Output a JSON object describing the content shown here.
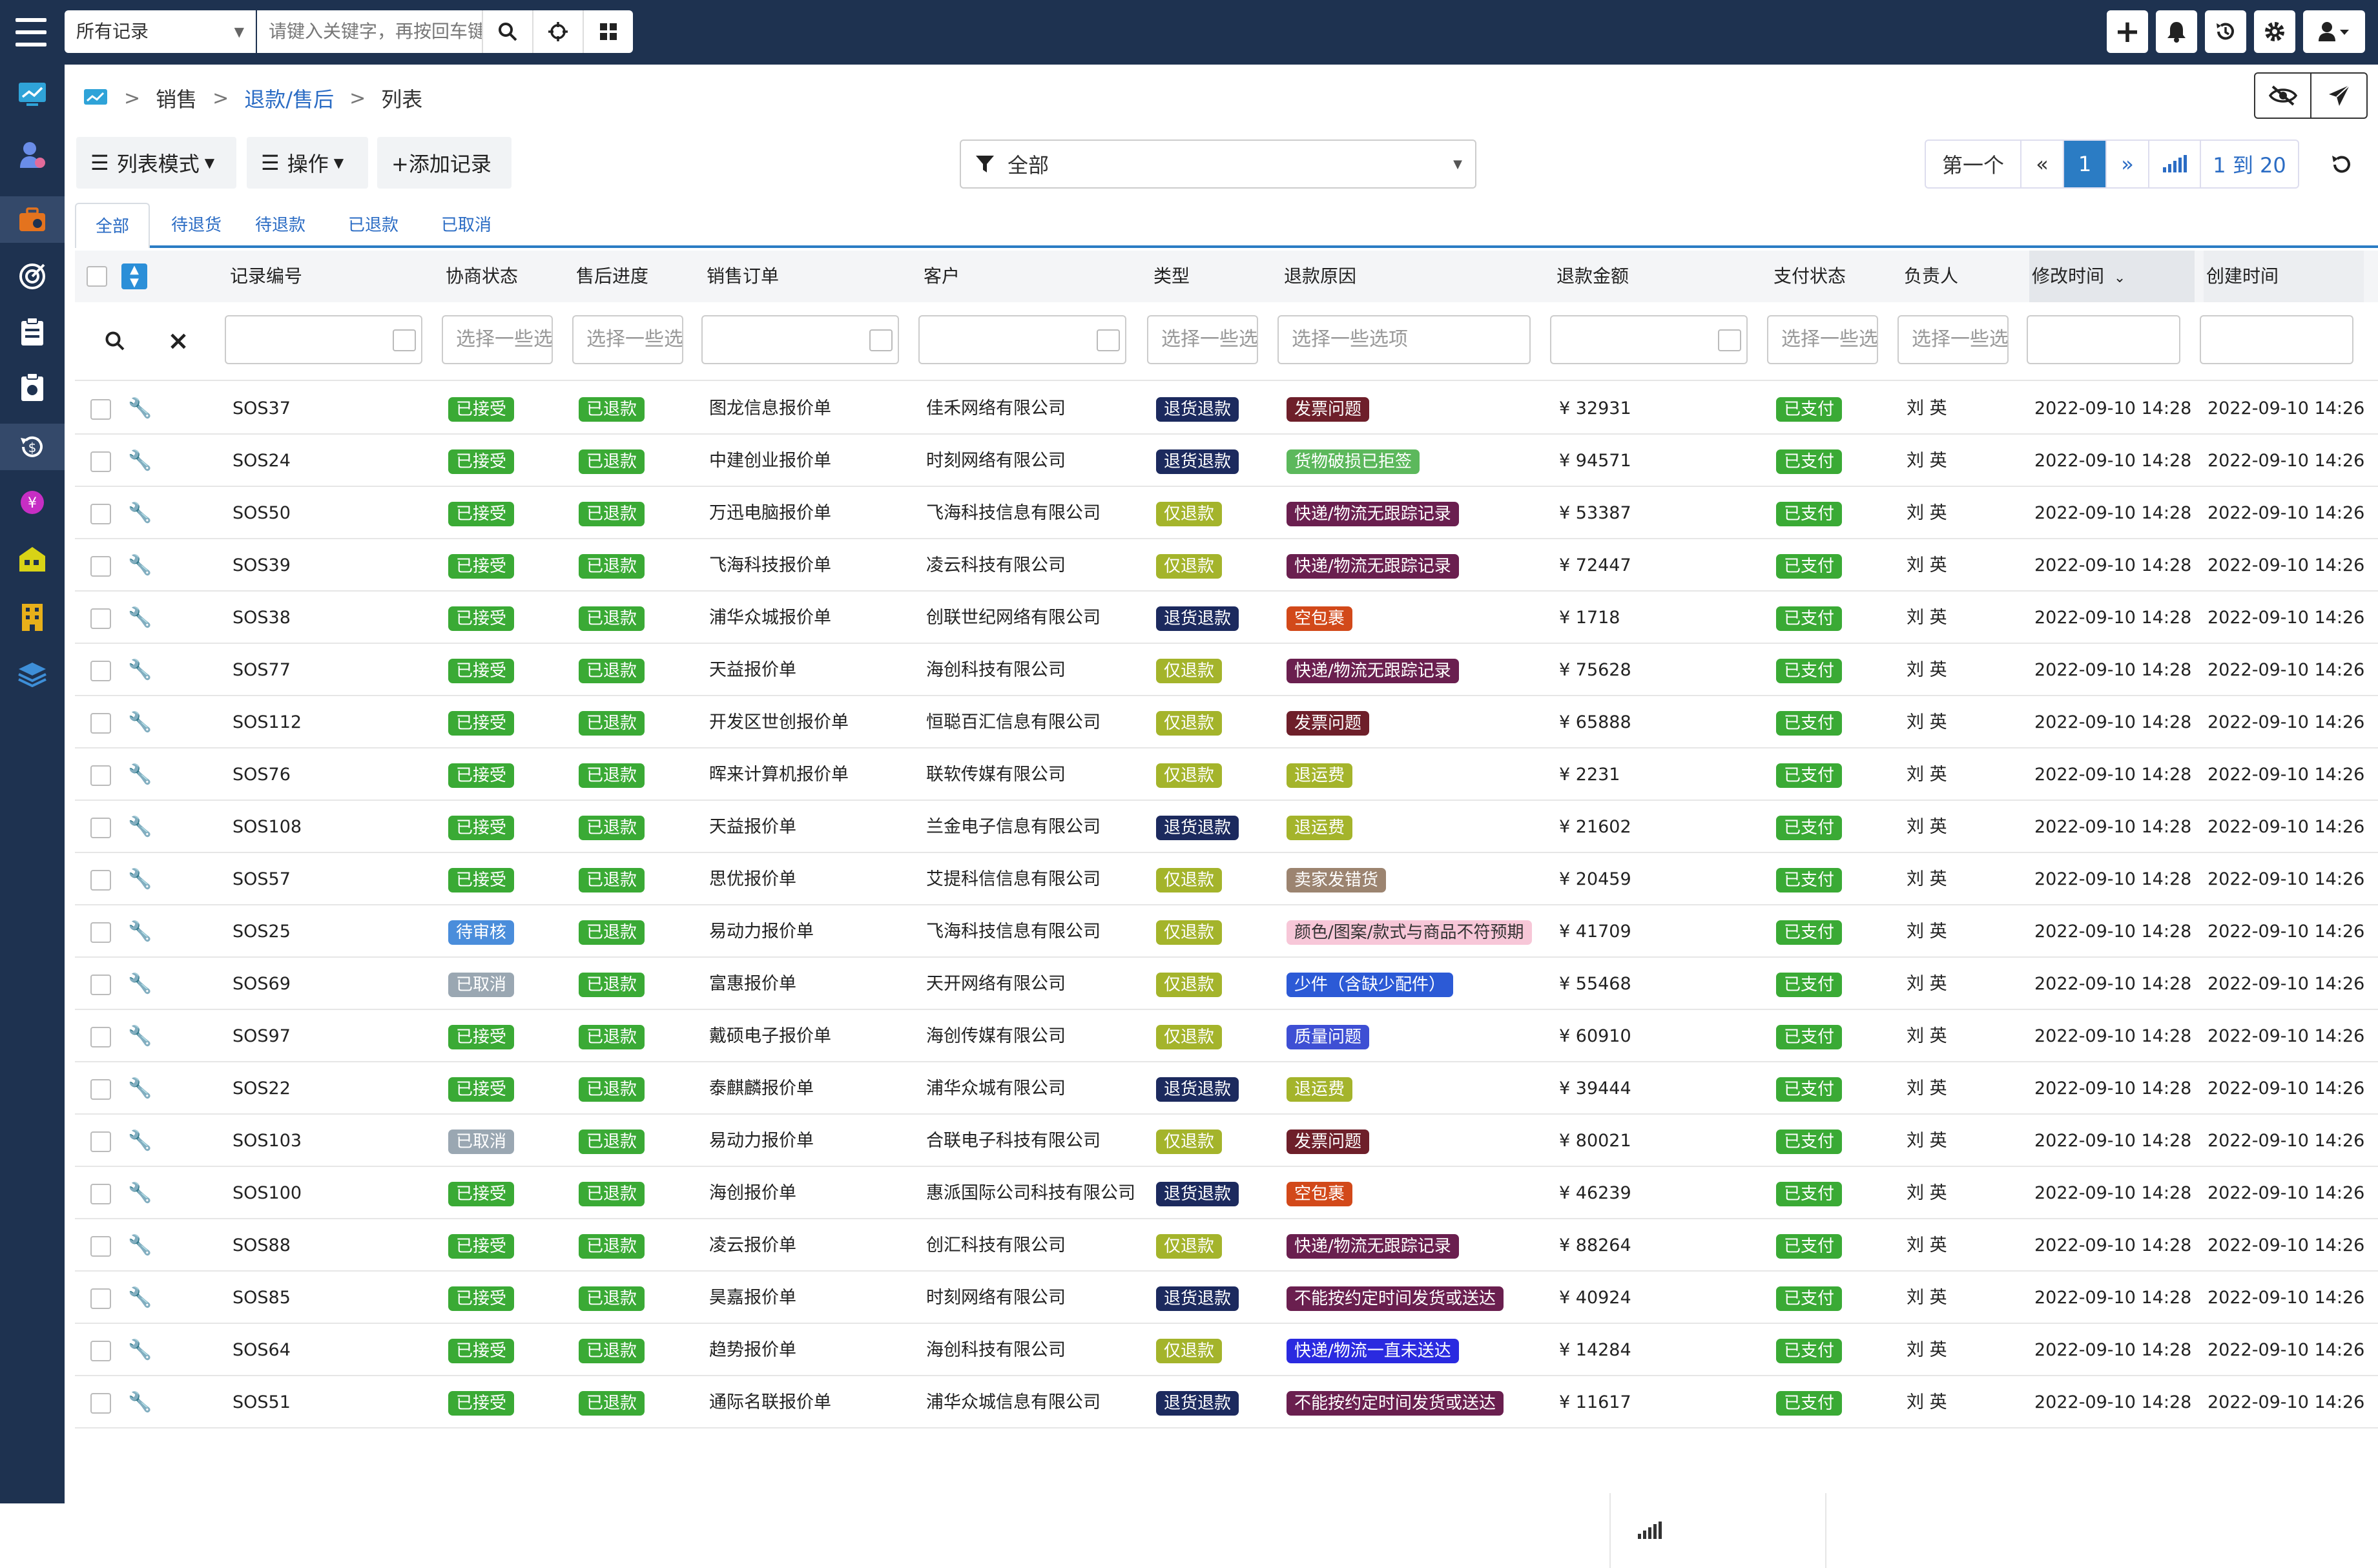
{
  "topbar": {
    "record_scope": "所有记录",
    "search_placeholder": "请键入关键字，再按回车键"
  },
  "breadcrumb": {
    "level1": "销售",
    "level2": "退款/售后",
    "level3": "列表"
  },
  "toolbar": {
    "view_mode": "列表模式",
    "operations": "操作",
    "add_record": "+添加记录",
    "filter_value": "全部"
  },
  "pager": {
    "first": "第一个",
    "prev": "«",
    "current": "1",
    "next": "»",
    "range": "1 到 20"
  },
  "tabs": [
    "全部",
    "待退货",
    "待退款",
    "已退款",
    "已取消"
  ],
  "columns": {
    "record_no": "记录编号",
    "negotiation": "协商状态",
    "progress": "售后进度",
    "sales_order": "销售订单",
    "customer": "客户",
    "type": "类型",
    "reason": "退款原因",
    "amount": "退款金额",
    "pay_status": "支付状态",
    "owner": "负责人",
    "modified": "修改时间",
    "created": "创建时间"
  },
  "filters": {
    "negotiation": "选择一些选项",
    "progress": "选择一些选项",
    "type": "选择一些选项",
    "reason": "选择一些选项",
    "pay_status": "选择一些选项",
    "owner": "选择一些选项"
  },
  "colors": {
    "green": "#3aaa35",
    "navy": "#1c2a5e",
    "olive": "#a4b42b",
    "maroon": "#6e1f2a",
    "red": "#a82c2c",
    "orange": "#d2491a",
    "purple": "#6a1f4f",
    "lightgreen": "#5cb85c",
    "brown": "#9c8470",
    "pink": "#f7c7d8",
    "blue": "#2c5ad6",
    "gray": "#9aa7b2",
    "sky": "#4a8ddb",
    "royal": "#2a2ae0",
    "indigo": "#3e4fd4"
  },
  "rows": [
    {
      "no": "SOS37",
      "neg": "已接受",
      "negc": "green",
      "prog": "已退款",
      "order": "图龙信息报价单",
      "cust": "佳禾网络有限公司",
      "type": "退货退款",
      "typec": "navy",
      "reason": "发票问题",
      "reasonc": "maroon",
      "amount": "¥ 32931",
      "pay": "已支付",
      "owner": "刘 英",
      "mod": "2022-09-10 14:28",
      "cre": "2022-09-10 14:26"
    },
    {
      "no": "SOS24",
      "neg": "已接受",
      "negc": "green",
      "prog": "已退款",
      "order": "中建创业报价单",
      "cust": "时刻网络有限公司",
      "type": "退货退款",
      "typec": "navy",
      "reason": "货物破损已拒签",
      "reasonc": "lightgreen",
      "amount": "¥ 94571",
      "pay": "已支付",
      "owner": "刘 英",
      "mod": "2022-09-10 14:28",
      "cre": "2022-09-10 14:26"
    },
    {
      "no": "SOS50",
      "neg": "已接受",
      "negc": "green",
      "prog": "已退款",
      "order": "万迅电脑报价单",
      "cust": "飞海科技信息有限公司",
      "type": "仅退款",
      "typec": "olive",
      "reason": "快递/物流无跟踪记录",
      "reasonc": "purple",
      "amount": "¥ 53387",
      "pay": "已支付",
      "owner": "刘 英",
      "mod": "2022-09-10 14:28",
      "cre": "2022-09-10 14:26"
    },
    {
      "no": "SOS39",
      "neg": "已接受",
      "negc": "green",
      "prog": "已退款",
      "order": "飞海科技报价单",
      "cust": "凌云科技有限公司",
      "type": "仅退款",
      "typec": "olive",
      "reason": "快递/物流无跟踪记录",
      "reasonc": "purple",
      "amount": "¥ 72447",
      "pay": "已支付",
      "owner": "刘 英",
      "mod": "2022-09-10 14:28",
      "cre": "2022-09-10 14:26"
    },
    {
      "no": "SOS38",
      "neg": "已接受",
      "negc": "green",
      "prog": "已退款",
      "order": "浦华众城报价单",
      "cust": "创联世纪网络有限公司",
      "type": "退货退款",
      "typec": "navy",
      "reason": "空包裹",
      "reasonc": "orange",
      "amount": "¥ 1718",
      "pay": "已支付",
      "owner": "刘 英",
      "mod": "2022-09-10 14:28",
      "cre": "2022-09-10 14:26"
    },
    {
      "no": "SOS77",
      "neg": "已接受",
      "negc": "green",
      "prog": "已退款",
      "order": "天益报价单",
      "cust": "海创科技有限公司",
      "type": "仅退款",
      "typec": "olive",
      "reason": "快递/物流无跟踪记录",
      "reasonc": "purple",
      "amount": "¥ 75628",
      "pay": "已支付",
      "owner": "刘 英",
      "mod": "2022-09-10 14:28",
      "cre": "2022-09-10 14:26"
    },
    {
      "no": "SOS112",
      "neg": "已接受",
      "negc": "green",
      "prog": "已退款",
      "order": "开发区世创报价单",
      "cust": "恒聪百汇信息有限公司",
      "type": "仅退款",
      "typec": "olive",
      "reason": "发票问题",
      "reasonc": "maroon",
      "amount": "¥ 65888",
      "pay": "已支付",
      "owner": "刘 英",
      "mod": "2022-09-10 14:28",
      "cre": "2022-09-10 14:26"
    },
    {
      "no": "SOS76",
      "neg": "已接受",
      "negc": "green",
      "prog": "已退款",
      "order": "晖来计算机报价单",
      "cust": "联软传媒有限公司",
      "type": "仅退款",
      "typec": "olive",
      "reason": "退运费",
      "reasonc": "olive",
      "amount": "¥ 2231",
      "pay": "已支付",
      "owner": "刘 英",
      "mod": "2022-09-10 14:28",
      "cre": "2022-09-10 14:26"
    },
    {
      "no": "SOS108",
      "neg": "已接受",
      "negc": "green",
      "prog": "已退款",
      "order": "天益报价单",
      "cust": "兰金电子信息有限公司",
      "type": "退货退款",
      "typec": "navy",
      "reason": "退运费",
      "reasonc": "olive",
      "amount": "¥ 21602",
      "pay": "已支付",
      "owner": "刘 英",
      "mod": "2022-09-10 14:28",
      "cre": "2022-09-10 14:26"
    },
    {
      "no": "SOS57",
      "neg": "已接受",
      "negc": "green",
      "prog": "已退款",
      "order": "思优报价单",
      "cust": "艾提科信信息有限公司",
      "type": "仅退款",
      "typec": "olive",
      "reason": "卖家发错货",
      "reasonc": "brown",
      "amount": "¥ 20459",
      "pay": "已支付",
      "owner": "刘 英",
      "mod": "2022-09-10 14:28",
      "cre": "2022-09-10 14:26"
    },
    {
      "no": "SOS25",
      "neg": "待审核",
      "negc": "sky",
      "prog": "已退款",
      "order": "易动力报价单",
      "cust": "飞海科技信息有限公司",
      "type": "仅退款",
      "typec": "olive",
      "reason": "颜色/图案/款式与商品不符预期",
      "reasonc": "pink",
      "amount": "¥ 41709",
      "pay": "已支付",
      "owner": "刘 英",
      "mod": "2022-09-10 14:28",
      "cre": "2022-09-10 14:26"
    },
    {
      "no": "SOS69",
      "neg": "已取消",
      "negc": "gray",
      "prog": "已退款",
      "order": "富惠报价单",
      "cust": "天开网络有限公司",
      "type": "仅退款",
      "typec": "olive",
      "reason": "少件（含缺少配件）",
      "reasonc": "blue",
      "amount": "¥ 55468",
      "pay": "已支付",
      "owner": "刘 英",
      "mod": "2022-09-10 14:28",
      "cre": "2022-09-10 14:26"
    },
    {
      "no": "SOS97",
      "neg": "已接受",
      "negc": "green",
      "prog": "已退款",
      "order": "戴硕电子报价单",
      "cust": "海创传媒有限公司",
      "type": "仅退款",
      "typec": "olive",
      "reason": "质量问题",
      "reasonc": "indigo",
      "amount": "¥ 60910",
      "pay": "已支付",
      "owner": "刘 英",
      "mod": "2022-09-10 14:28",
      "cre": "2022-09-10 14:26"
    },
    {
      "no": "SOS22",
      "neg": "已接受",
      "negc": "green",
      "prog": "已退款",
      "order": "泰麒麟报价单",
      "cust": "浦华众城有限公司",
      "type": "退货退款",
      "typec": "navy",
      "reason": "退运费",
      "reasonc": "olive",
      "amount": "¥ 39444",
      "pay": "已支付",
      "owner": "刘 英",
      "mod": "2022-09-10 14:28",
      "cre": "2022-09-10 14:26"
    },
    {
      "no": "SOS103",
      "neg": "已取消",
      "negc": "gray",
      "prog": "已退款",
      "order": "易动力报价单",
      "cust": "合联电子科技有限公司",
      "type": "仅退款",
      "typec": "olive",
      "reason": "发票问题",
      "reasonc": "maroon",
      "amount": "¥ 80021",
      "pay": "已支付",
      "owner": "刘 英",
      "mod": "2022-09-10 14:28",
      "cre": "2022-09-10 14:26"
    },
    {
      "no": "SOS100",
      "neg": "已接受",
      "negc": "green",
      "prog": "已退款",
      "order": "海创报价单",
      "cust": "惠派国际公司科技有限公司",
      "type": "退货退款",
      "typec": "navy",
      "reason": "空包裹",
      "reasonc": "orange",
      "amount": "¥ 46239",
      "pay": "已支付",
      "owner": "刘 英",
      "mod": "2022-09-10 14:28",
      "cre": "2022-09-10 14:26"
    },
    {
      "no": "SOS88",
      "neg": "已接受",
      "negc": "green",
      "prog": "已退款",
      "order": "凌云报价单",
      "cust": "创汇科技有限公司",
      "type": "仅退款",
      "typec": "olive",
      "reason": "快递/物流无跟踪记录",
      "reasonc": "purple",
      "amount": "¥ 88264",
      "pay": "已支付",
      "owner": "刘 英",
      "mod": "2022-09-10 14:28",
      "cre": "2022-09-10 14:26"
    },
    {
      "no": "SOS85",
      "neg": "已接受",
      "negc": "green",
      "prog": "已退款",
      "order": "昊嘉报价单",
      "cust": "时刻网络有限公司",
      "type": "退货退款",
      "typec": "navy",
      "reason": "不能按约定时间发货或送达",
      "reasonc": "purple",
      "amount": "¥ 40924",
      "pay": "已支付",
      "owner": "刘 英",
      "mod": "2022-09-10 14:28",
      "cre": "2022-09-10 14:26"
    },
    {
      "no": "SOS64",
      "neg": "已接受",
      "negc": "green",
      "prog": "已退款",
      "order": "趋势报价单",
      "cust": "海创科技有限公司",
      "type": "仅退款",
      "typec": "olive",
      "reason": "快递/物流一直未送达",
      "reasonc": "royal",
      "amount": "¥ 14284",
      "pay": "已支付",
      "owner": "刘 英",
      "mod": "2022-09-10 14:28",
      "cre": "2022-09-10 14:26"
    },
    {
      "no": "SOS51",
      "neg": "已接受",
      "negc": "green",
      "prog": "已退款",
      "order": "通际名联报价单",
      "cust": "浦华众城信息有限公司",
      "type": "退货退款",
      "typec": "navy",
      "reason": "不能按约定时间发货或送达",
      "reasonc": "purple",
      "amount": "¥ 11617",
      "pay": "已支付",
      "owner": "刘 英",
      "mod": "2022-09-10 14:28",
      "cre": "2022-09-10 14:26"
    }
  ]
}
